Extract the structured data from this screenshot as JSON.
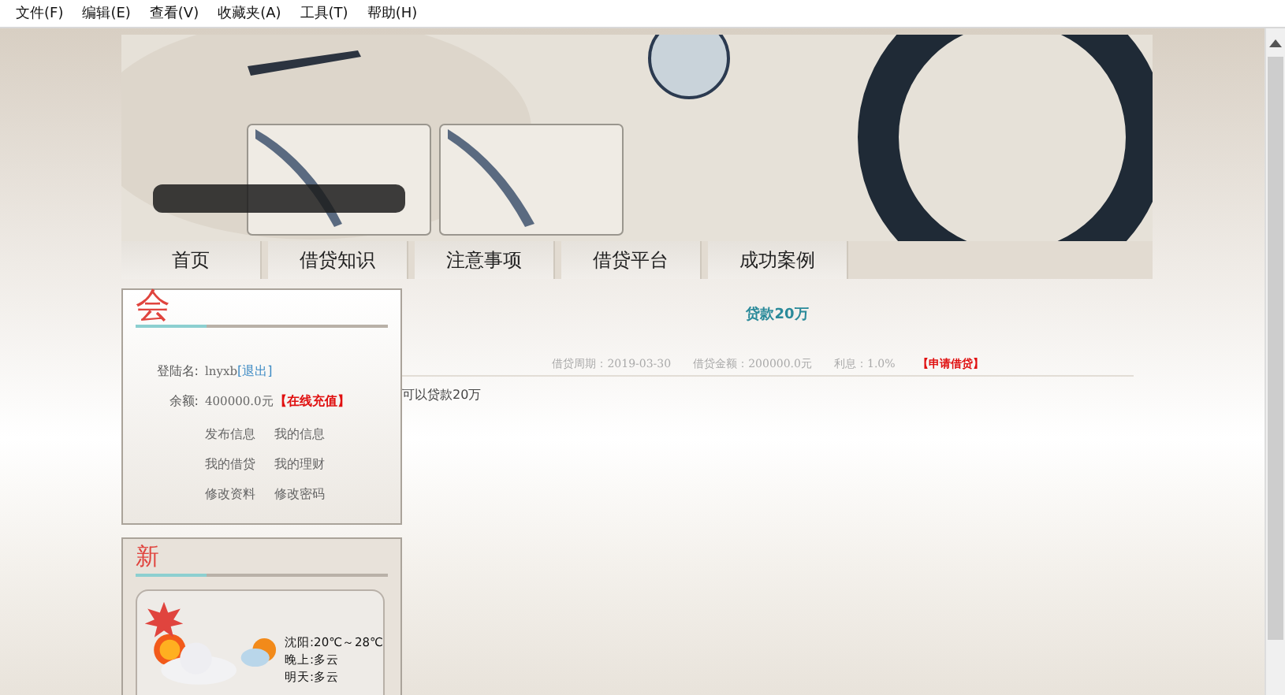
{
  "menu_bar": [
    "文件(F)",
    "编辑(E)",
    "查看(V)",
    "收藏夹(A)",
    "工具(T)",
    "帮助(H)"
  ],
  "nav": [
    {
      "label": "首页",
      "selected": false
    },
    {
      "label": "借贷知识",
      "selected": false
    },
    {
      "label": "注意事项",
      "selected": false
    },
    {
      "label": "借贷平台",
      "selected": false
    },
    {
      "label": "成功案例",
      "selected": false
    }
  ],
  "member_panel": {
    "heading": "会",
    "rows": [
      {
        "label": "登陆名:",
        "value": "lnyxb",
        "link": "[退出]",
        "kind": "plain"
      },
      {
        "label": "余额:",
        "value": "400000.0元",
        "link": "【在线充值】",
        "kind": "alert"
      }
    ],
    "links": [
      [
        "发布信息",
        "我的信息"
      ],
      [
        "我的借贷",
        "我的理财"
      ],
      [
        "修改资料",
        "修改密码"
      ]
    ]
  },
  "news_panel": {
    "heading": "新",
    "weather": [
      "沈阳:20℃～28℃",
      "晚上:多云",
      "明天:多云"
    ]
  },
  "loan": {
    "title": "贷款20万",
    "period": "借贷周期：2019-03-30",
    "amount": "借贷金额：200000.0元",
    "interest": "利息：1.0%",
    "apply": "【申请借贷】",
    "description": "可以贷款20万"
  }
}
